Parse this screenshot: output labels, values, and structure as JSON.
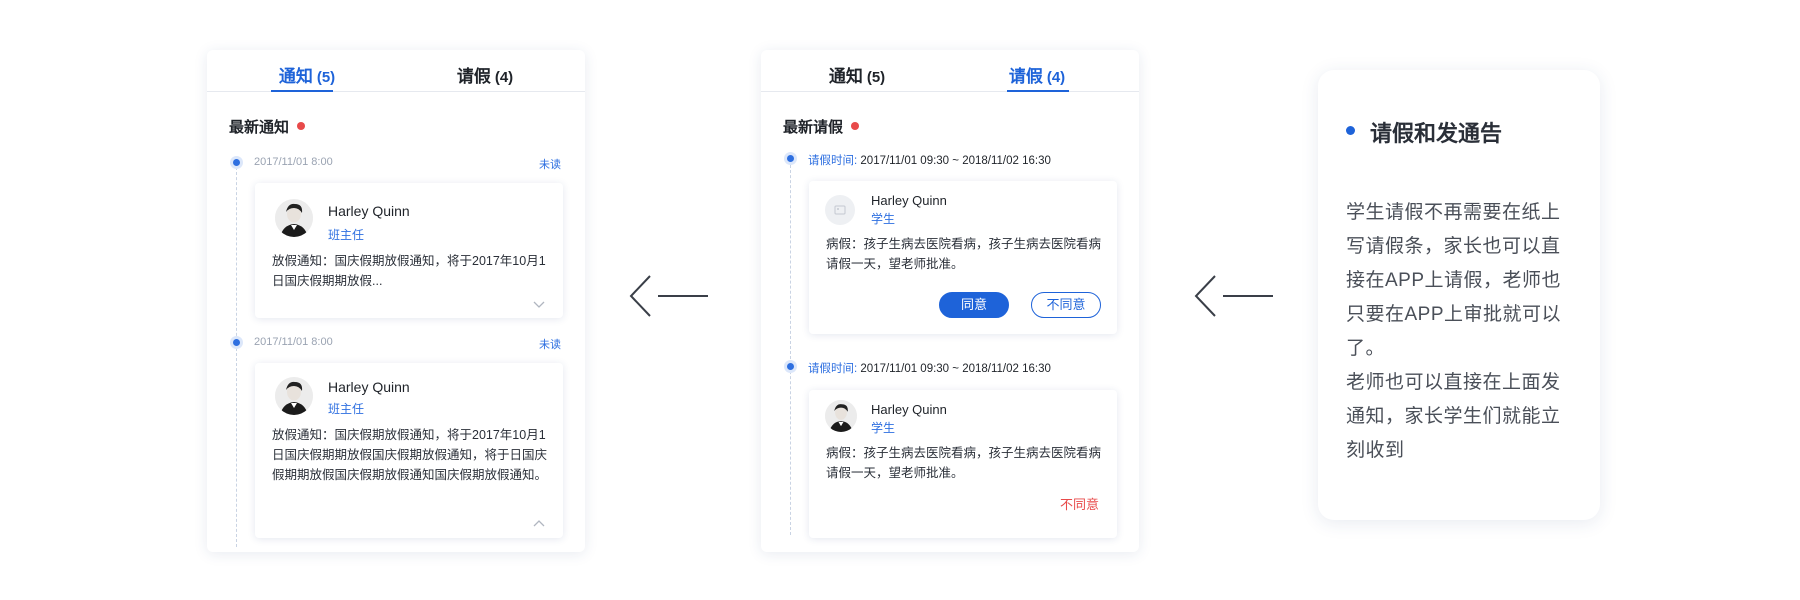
{
  "notice_panel": {
    "tabs": [
      {
        "label": "通知",
        "count": "(5)"
      },
      {
        "label": "请假",
        "count": "(4)"
      }
    ],
    "section_title": "最新通知",
    "items": [
      {
        "date": "2017/11/01  8:00",
        "status": "未读",
        "name": "Harley Quinn",
        "role": "班主任",
        "text": "放假通知：国庆假期放假通知，将于2017年10月1日国庆假期期放假..."
      },
      {
        "date": "2017/11/01  8:00",
        "status": "未读",
        "name": "Harley Quinn",
        "role": "班主任",
        "text": "放假通知：国庆假期放假通知，将于2017年10月1日国庆假期期放假国庆假期放假通知，将于日国庆假期期放假国庆假期放假通知国庆假期放假通知。"
      }
    ]
  },
  "leave_panel": {
    "tabs": [
      {
        "label": "通知",
        "count": "(5)"
      },
      {
        "label": "请假",
        "count": "(4)"
      }
    ],
    "section_title": "最新请假",
    "time_key": "请假时间:",
    "items": [
      {
        "time_range": "2017/11/01 09:30 ~ 2018/11/02 16:30",
        "name": "Harley Quinn",
        "role": "学生",
        "text": "病假：孩子生病去医院看病，孩子生病去医院看病请假一天，望老师批准。",
        "agree_label": "同意",
        "reject_label": "不同意"
      },
      {
        "time_range": "2017/11/01 09:30 ~ 2018/11/02 16:30",
        "name": "Harley Quinn",
        "role": "学生",
        "text": "病假：孩子生病去医院看病，孩子生病去医院看病请假一天，望老师批准。",
        "result_label": "不同意"
      }
    ]
  },
  "info_card": {
    "title": "请假和发通告",
    "paragraphs": [
      "学生请假不再需要在纸上写请假条，家长也可以直接在APP上请假，老师也只要在APP上审批就可以了。",
      "老师也可以直接在上面发通知，家长学生们就能立刻收到"
    ]
  },
  "colors": {
    "accent": "#1e63d9",
    "alert": "#e84a4a",
    "muted": "#9aa3b2"
  },
  "icons": [
    "chevron-down-icon",
    "chevron-up-icon",
    "left-arrow-icon",
    "avatar-image",
    "avatar-placeholder-icon"
  ]
}
